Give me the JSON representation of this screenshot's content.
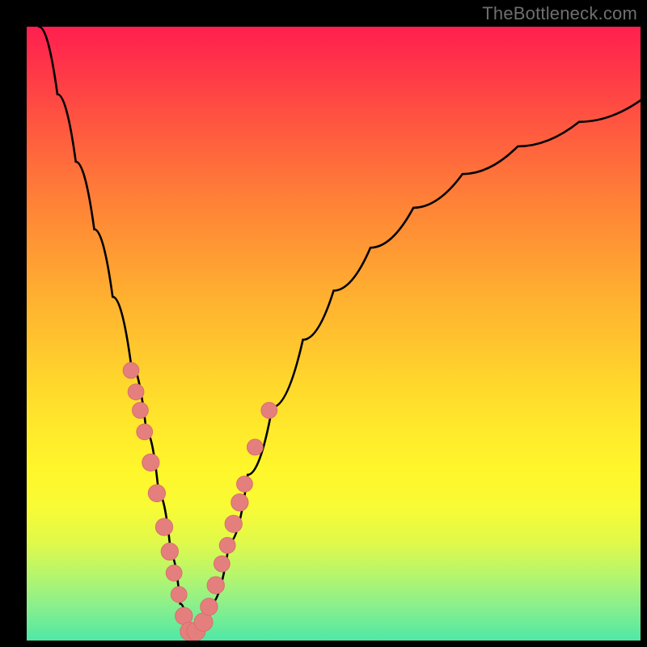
{
  "attribution": "TheBottleneck.com",
  "colors": {
    "marker_fill": "#e57f7d",
    "marker_stroke": "#d96e6c",
    "curve_stroke": "#000000",
    "frame": "#000000"
  },
  "chart_data": {
    "type": "line",
    "title": "",
    "xlabel": "",
    "ylabel": "",
    "xlim": [
      0,
      100
    ],
    "ylim": [
      0,
      100
    ],
    "series": [
      {
        "name": "bottleneck-curve",
        "x": [
          2,
          5,
          8,
          11,
          14,
          17,
          19.5,
          21.5,
          23.5,
          25,
          26.5,
          28,
          30,
          33,
          36,
          40,
          45,
          50,
          56,
          63,
          71,
          80,
          90,
          100
        ],
        "y": [
          100,
          89,
          78,
          67,
          56,
          45,
          34,
          24,
          14,
          6,
          1,
          1,
          6,
          16,
          27,
          38,
          49,
          57,
          64,
          70.5,
          76,
          80.5,
          84.5,
          88
        ]
      }
    ],
    "markers": [
      {
        "x": 17.0,
        "y": 44.0,
        "r": 1.3
      },
      {
        "x": 17.8,
        "y": 40.5,
        "r": 1.3
      },
      {
        "x": 18.5,
        "y": 37.5,
        "r": 1.3
      },
      {
        "x": 19.2,
        "y": 34.0,
        "r": 1.3
      },
      {
        "x": 20.2,
        "y": 29.0,
        "r": 1.4
      },
      {
        "x": 21.2,
        "y": 24.0,
        "r": 1.4
      },
      {
        "x": 22.4,
        "y": 18.5,
        "r": 1.4
      },
      {
        "x": 23.3,
        "y": 14.5,
        "r": 1.4
      },
      {
        "x": 24.0,
        "y": 11.0,
        "r": 1.3
      },
      {
        "x": 24.8,
        "y": 7.5,
        "r": 1.3
      },
      {
        "x": 25.6,
        "y": 4.0,
        "r": 1.4
      },
      {
        "x": 26.5,
        "y": 1.5,
        "r": 1.5
      },
      {
        "x": 27.6,
        "y": 1.5,
        "r": 1.5
      },
      {
        "x": 28.8,
        "y": 3.0,
        "r": 1.5
      },
      {
        "x": 29.7,
        "y": 5.5,
        "r": 1.4
      },
      {
        "x": 30.8,
        "y": 9.0,
        "r": 1.4
      },
      {
        "x": 31.8,
        "y": 12.5,
        "r": 1.3
      },
      {
        "x": 32.7,
        "y": 15.5,
        "r": 1.3
      },
      {
        "x": 33.7,
        "y": 19.0,
        "r": 1.4
      },
      {
        "x": 34.7,
        "y": 22.5,
        "r": 1.4
      },
      {
        "x": 35.5,
        "y": 25.5,
        "r": 1.3
      },
      {
        "x": 37.2,
        "y": 31.5,
        "r": 1.3
      },
      {
        "x": 39.5,
        "y": 37.5,
        "r": 1.3
      }
    ]
  }
}
